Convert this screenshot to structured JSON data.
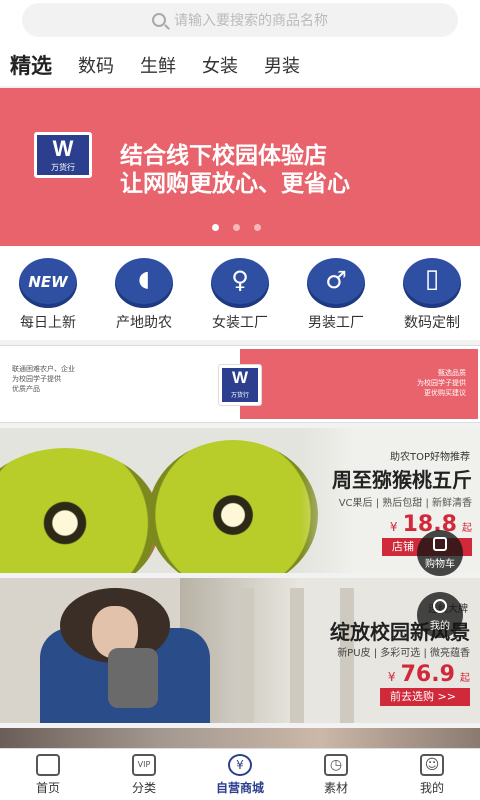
{
  "search": {
    "placeholder": "请输入要搜索的商品名称"
  },
  "tabs": [
    {
      "label": "精选",
      "active": true
    },
    {
      "label": "数码"
    },
    {
      "label": "生鲜"
    },
    {
      "label": "女装"
    },
    {
      "label": "男装"
    }
  ],
  "banner": {
    "brand_letter": "W",
    "brand_name": "万货行",
    "line1": "结合线下校园体验店",
    "line2": "让网购更放心、更省心",
    "color": "#e8636c",
    "dots_total": 3,
    "dot_active_index": 0
  },
  "categories": [
    {
      "label": "每日上新",
      "icon": "new-badge-icon",
      "glyph": "NEW"
    },
    {
      "label": "产地助农",
      "icon": "mango-icon",
      "glyph": "◖"
    },
    {
      "label": "女装工厂",
      "icon": "dress-icon",
      "glyph": "♀"
    },
    {
      "label": "男装工厂",
      "icon": "shirt-icon",
      "glyph": "♂"
    },
    {
      "label": "数码定制",
      "icon": "phone-icon",
      "glyph": "▯"
    }
  ],
  "promo_banner": {
    "left_lines": [
      "联通困难农户、企业",
      "为校园学子提供",
      "优质产品"
    ],
    "right_lines": [
      "甄选品质",
      "为校园学子提供",
      "更优购买建议"
    ],
    "brand_letter": "W",
    "brand_name": "万货行"
  },
  "product_kiwi": {
    "subtitle": "助农TOP好物推荐",
    "title": "周至猕猴桃五斤",
    "tags": "VC果后 | 熟后包甜 | 新鲜清香",
    "price_symbol": "¥",
    "price": "18.8",
    "price_suffix": "起",
    "cta": "店铺"
  },
  "product_fashion": {
    "subtitle": "连线大牌",
    "title": "绽放校园新风景",
    "tags": "新PU皮 | 多彩可选 | 微亮蕴香",
    "price_symbol": "¥",
    "price": "76.9",
    "price_suffix": "起",
    "cta": "前去选购 >>"
  },
  "floating": {
    "cart_label": "购物车",
    "mine_label": "我的"
  },
  "tabbar": [
    {
      "label": "首页",
      "icon": "home-icon",
      "glyph": ""
    },
    {
      "label": "分类",
      "icon": "vip-icon",
      "glyph": "VIP"
    },
    {
      "label": "自营商城",
      "icon": "yen-coin-icon",
      "glyph": "¥",
      "active": true
    },
    {
      "label": "素材",
      "icon": "clock-icon",
      "glyph": "◷"
    },
    {
      "label": "我的",
      "icon": "user-icon",
      "glyph": "☺"
    }
  ],
  "colors": {
    "accent": "#2b3f8e",
    "banner": "#e8636c",
    "price": "#d0293a"
  }
}
